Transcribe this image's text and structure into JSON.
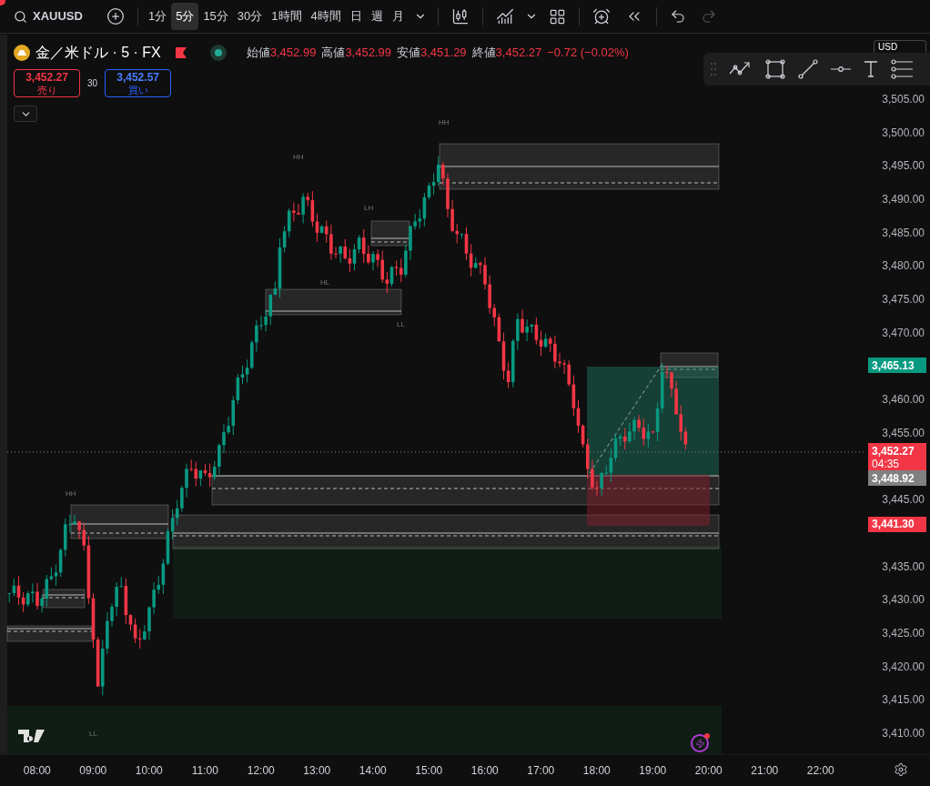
{
  "toolbar": {
    "symbol": "XAUUSD",
    "intervals": [
      {
        "label": "1分",
        "selected": false
      },
      {
        "label": "5分",
        "selected": true
      },
      {
        "label": "15分",
        "selected": false
      },
      {
        "label": "30分",
        "selected": false
      },
      {
        "label": "1時間",
        "selected": false
      },
      {
        "label": "4時間",
        "selected": false
      },
      {
        "label": "日",
        "selected": false
      },
      {
        "label": "週",
        "selected": false
      },
      {
        "label": "月",
        "selected": false
      }
    ],
    "redo_disabled": true
  },
  "legend": {
    "title": "金／米ドル · 5 · FX",
    "ohlc": [
      {
        "label": "始値",
        "value": "3,452.99"
      },
      {
        "label": "高値",
        "value": "3,452.99"
      },
      {
        "label": "安値",
        "value": "3,451.29"
      },
      {
        "label": "終値",
        "value": "3,452.27"
      }
    ],
    "change": "−0.72 (−0.02%)",
    "sell": {
      "price": "3,452.27",
      "label": "売り"
    },
    "spread": "30",
    "buy": {
      "price": "3,452.57",
      "label": "買い"
    }
  },
  "currency": "USD",
  "chart_labels": [
    {
      "text": "HH"
    },
    {
      "text": "HH"
    },
    {
      "text": "LH"
    },
    {
      "text": "HL"
    },
    {
      "text": "LL"
    },
    {
      "text": "HH"
    },
    {
      "text": "LL"
    }
  ],
  "price_axis": {
    "ticks": [
      "3,505.00",
      "3,500.00",
      "3,495.00",
      "3,490.00",
      "3,485.00",
      "3,480.00",
      "3,475.00",
      "3,470.00",
      "3,460.00",
      "3,455.00",
      "3,445.00",
      "3,435.00",
      "3,430.00",
      "3,425.00",
      "3,420.00",
      "3,415.00",
      "3,410.00"
    ],
    "tags": [
      {
        "label": "3,465.13",
        "color": "#089981"
      },
      {
        "label": "3,452.27",
        "countdown": "04:35",
        "color": "#f23645"
      },
      {
        "label": "3,448.92",
        "color": "#808080"
      },
      {
        "label": "3,441.30",
        "color": "#f23645"
      }
    ]
  },
  "time_axis": [
    "08:00",
    "09:00",
    "10:00",
    "11:00",
    "12:00",
    "13:00",
    "14:00",
    "15:00",
    "16:00",
    "17:00",
    "18:00",
    "19:00",
    "20:00",
    "21:00",
    "22:00"
  ]
}
